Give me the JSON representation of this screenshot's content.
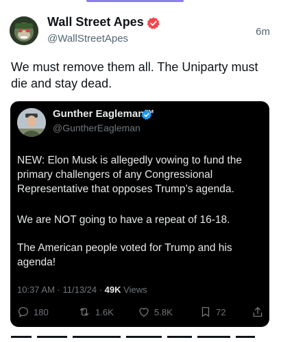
{
  "post": {
    "display_name": "Wall Street Apes",
    "handle": "@WallStreetApes",
    "time": "6m",
    "text": "We must remove them all. The Uniparty must die and stay dead."
  },
  "quote": {
    "display_name": "Gunther Eagleman™",
    "handle": "@GuntherEagleman",
    "paragraphs": [
      "NEW: Elon Musk is allegedly vowing to fund the primary challengers of any Congressional Representative that opposes Trump’s agenda.",
      "We are NOT going to have a repeat of 16-18.",
      "The American people voted for Trump and his agenda!"
    ],
    "meta_prefix": "10:37 AM · 11/13/24 · ",
    "views_count": "49K",
    "views_label": " Views",
    "actions": {
      "replies": "180",
      "reposts": "1.6K",
      "likes": "5.8K",
      "bookmarks": "72"
    }
  },
  "icons": {
    "verified_outer": "verified-badge-red",
    "verified_inner": "verified-badge-blue",
    "reply": "reply-icon",
    "repost": "repost-icon",
    "like": "like-icon",
    "bookmark": "bookmark-icon",
    "share": "share-icon"
  },
  "colors": {
    "verified_outer": "#f0464f",
    "verified_inner": "#1d9bf0",
    "quote_background": "#000000",
    "muted_text": "#536471",
    "tab_indicator": "#8b7fe8"
  }
}
